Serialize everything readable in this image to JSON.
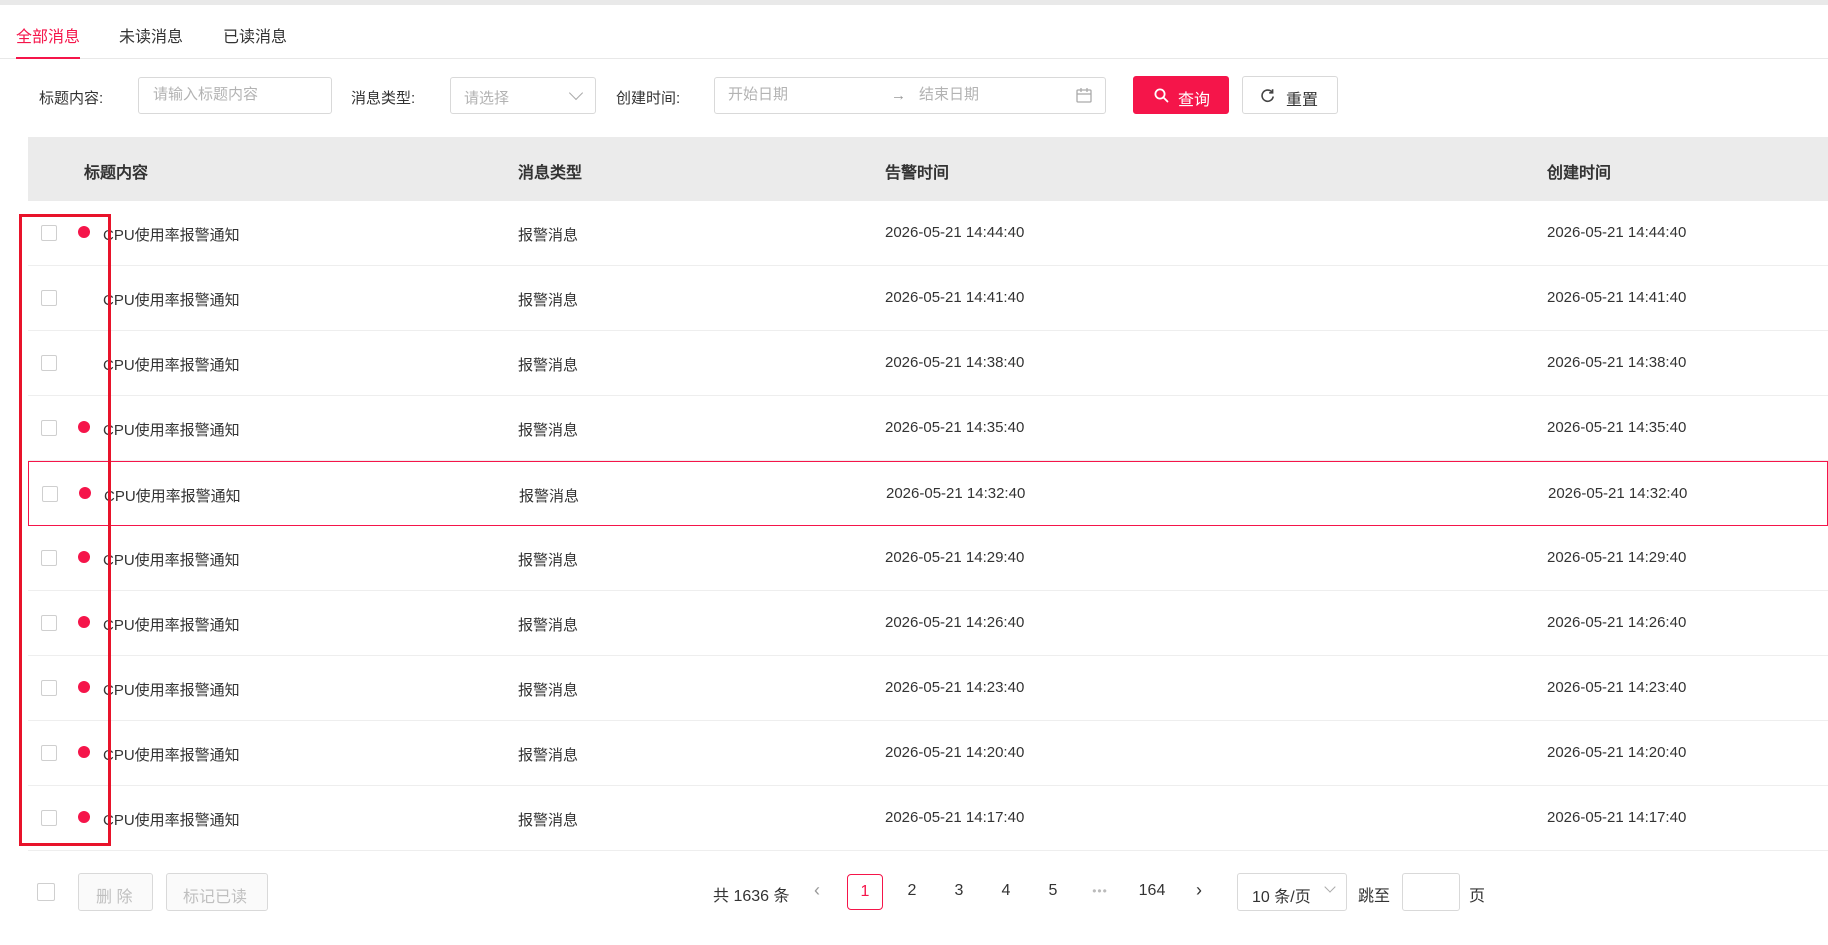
{
  "tabs": [
    "全部消息",
    "未读消息",
    "已读消息"
  ],
  "filters": {
    "title_label": "标题内容:",
    "title_placeholder": "请输入标题内容",
    "type_label": "消息类型:",
    "type_placeholder": "请选择",
    "time_label": "创建时间:",
    "start_placeholder": "开始日期",
    "end_placeholder": "结束日期",
    "range_separator": "→",
    "query_label": "查询",
    "reset_label": "重置"
  },
  "table": {
    "headers": [
      "标题内容",
      "消息类型",
      "告警时间",
      "创建时间"
    ],
    "rows": [
      {
        "unread": true,
        "title": "CPU使用率报警通知",
        "type": "报警消息",
        "alert_time": "2026-05-21 14:44:40",
        "create_time": "2026-05-21 14:44:40"
      },
      {
        "unread": false,
        "title": "CPU使用率报警通知",
        "type": "报警消息",
        "alert_time": "2026-05-21 14:41:40",
        "create_time": "2026-05-21 14:41:40"
      },
      {
        "unread": false,
        "title": "CPU使用率报警通知",
        "type": "报警消息",
        "alert_time": "2026-05-21 14:38:40",
        "create_time": "2026-05-21 14:38:40"
      },
      {
        "unread": true,
        "title": "CPU使用率报警通知",
        "type": "报警消息",
        "alert_time": "2026-05-21 14:35:40",
        "create_time": "2026-05-21 14:35:40"
      },
      {
        "unread": true,
        "title": "CPU使用率报警通知",
        "type": "报警消息",
        "alert_time": "2026-05-21 14:32:40",
        "create_time": "2026-05-21 14:32:40",
        "highlighted": true
      },
      {
        "unread": true,
        "title": "CPU使用率报警通知",
        "type": "报警消息",
        "alert_time": "2026-05-21 14:29:40",
        "create_time": "2026-05-21 14:29:40"
      },
      {
        "unread": true,
        "title": "CPU使用率报警通知",
        "type": "报警消息",
        "alert_time": "2026-05-21 14:26:40",
        "create_time": "2026-05-21 14:26:40"
      },
      {
        "unread": true,
        "title": "CPU使用率报警通知",
        "type": "报警消息",
        "alert_time": "2026-05-21 14:23:40",
        "create_time": "2026-05-21 14:23:40"
      },
      {
        "unread": true,
        "title": "CPU使用率报警通知",
        "type": "报警消息",
        "alert_time": "2026-05-21 14:20:40",
        "create_time": "2026-05-21 14:20:40"
      },
      {
        "unread": true,
        "title": "CPU使用率报警通知",
        "type": "报警消息",
        "alert_time": "2026-05-21 14:17:40",
        "create_time": "2026-05-21 14:17:40"
      }
    ]
  },
  "footer": {
    "delete_label": "删 除",
    "mark_read_label": "标记已读",
    "total_text": "共 1636 条",
    "pages": [
      "1",
      "2",
      "3",
      "4",
      "5"
    ],
    "ellipsis": "•••",
    "last_page": "164",
    "current_page": "1",
    "page_size_label": "10 条/页",
    "jump_label": "跳至",
    "page_unit": "页"
  },
  "colors": {
    "accent": "#f5154a",
    "annotation_box": "#e8132a",
    "header_bg": "#ebebeb"
  }
}
